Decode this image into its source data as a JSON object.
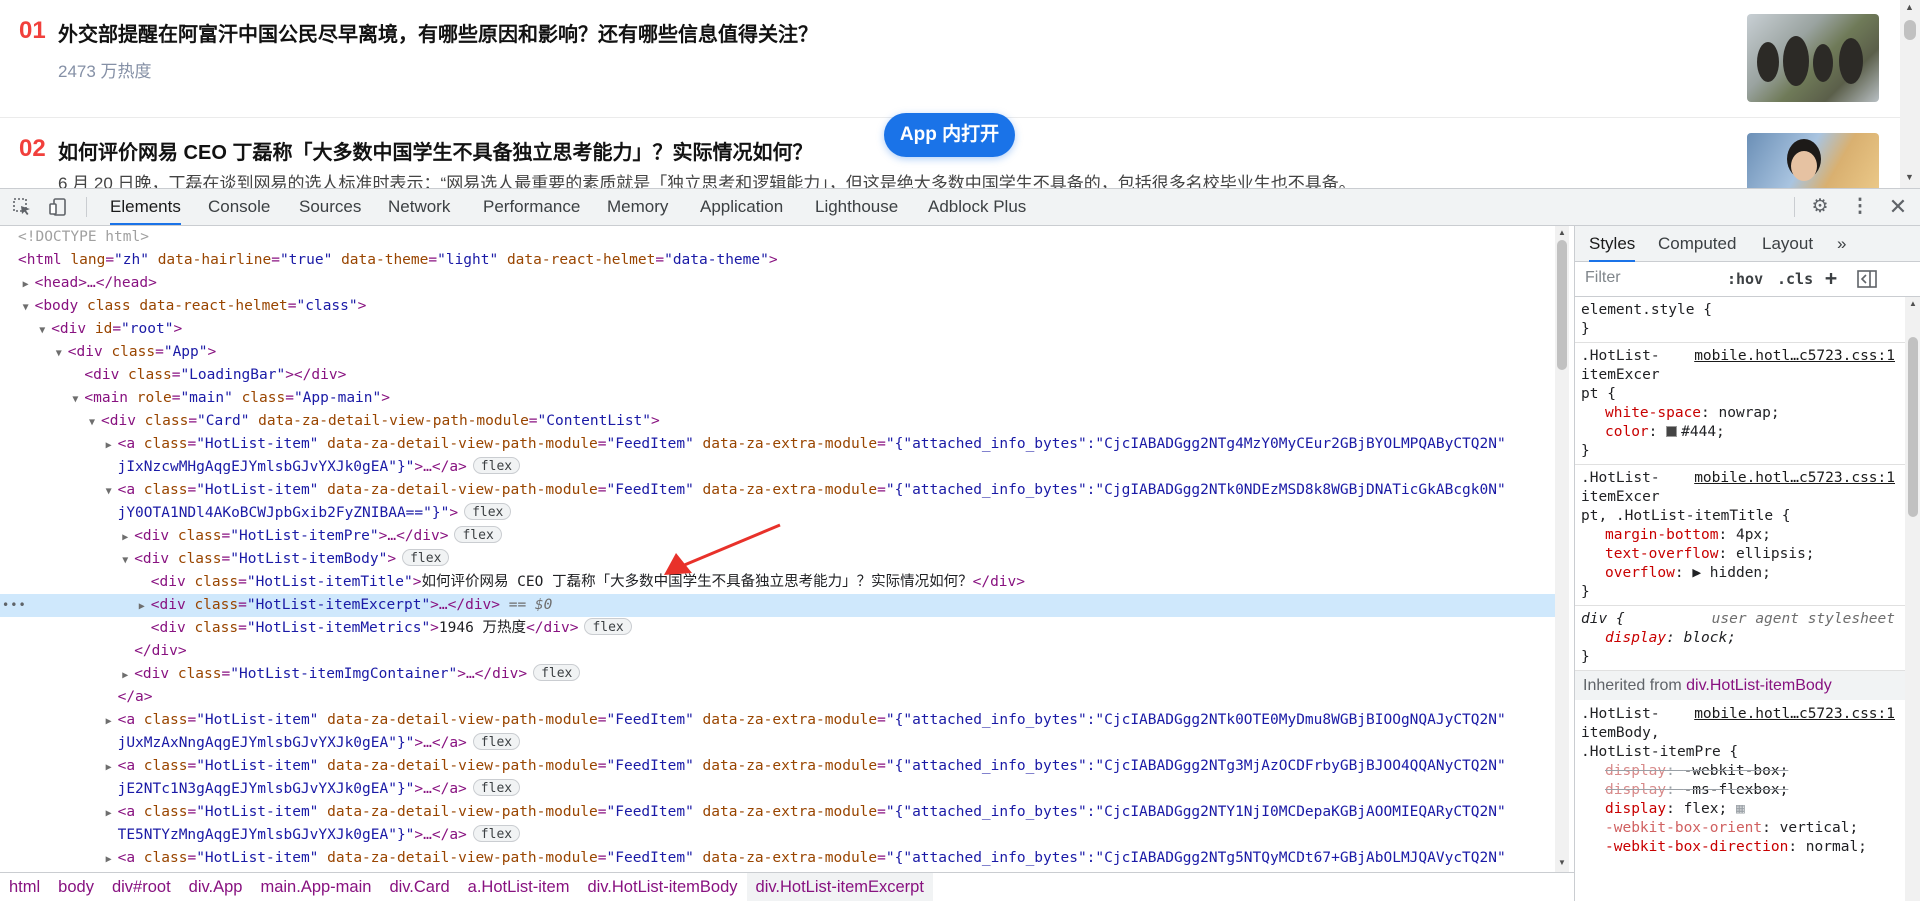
{
  "page": {
    "items": [
      {
        "rank": "01",
        "title": "外交部提醒在阿富汗中国公民尽早离境，有哪些原因和影响？还有哪些信息值得关注？",
        "metric": "2473 万热度"
      },
      {
        "rank": "02",
        "title": "如何评价网易 CEO 丁磊称「大多数中国学生不具备独立思考能力」？实际情况如何？",
        "excerpt": "6 月 20 日晚，丁磊在谈到网易的选人标准时表示：“网易选人最重要的素质就是「独立思考和逻辑能力」，但这是绝大多数中国学生不具备的，包括很多名校毕业生也不具备。"
      }
    ],
    "app_button": "App 内打开"
  },
  "devtools": {
    "tabs": [
      "Elements",
      "Console",
      "Sources",
      "Network",
      "Performance",
      "Memory",
      "Application",
      "Lighthouse",
      "Adblock Plus"
    ],
    "active_tab": "Elements",
    "tree": [
      {
        "indent": 0,
        "tri": "",
        "html": "doctype",
        "text": "<!DOCTYPE html>"
      },
      {
        "indent": 0,
        "tri": "",
        "tag": "html",
        "attrs": [
          [
            "lang",
            "zh"
          ],
          [
            "data-hairline",
            "true"
          ],
          [
            "data-theme",
            "light"
          ],
          [
            "data-react-helmet",
            "data-theme"
          ]
        ],
        "close": ">"
      },
      {
        "indent": 1,
        "tri": "▶",
        "tag": "head",
        "tail": ">…</head>"
      },
      {
        "indent": 1,
        "tri": "▼",
        "tag": "body",
        "attrs": [
          [
            "class",
            null
          ],
          [
            "data-react-helmet",
            "class"
          ]
        ],
        "close": ">"
      },
      {
        "indent": 2,
        "tri": "▼",
        "tag": "div",
        "attrs": [
          [
            "id",
            "root"
          ]
        ],
        "close": ">"
      },
      {
        "indent": 3,
        "tri": "▼",
        "tag": "div",
        "attrs": [
          [
            "class",
            "App"
          ]
        ],
        "close": ">"
      },
      {
        "indent": 4,
        "tri": "",
        "tag": "div",
        "attrs": [
          [
            "class",
            "LoadingBar"
          ]
        ],
        "tail": "></div>"
      },
      {
        "indent": 4,
        "tri": "▼",
        "tag": "main",
        "attrs": [
          [
            "role",
            "main"
          ],
          [
            "class",
            "App-main"
          ]
        ],
        "close": ">"
      },
      {
        "indent": 5,
        "tri": "▼",
        "tag": "div",
        "attrs": [
          [
            "class",
            "Card"
          ],
          [
            "data-za-detail-view-path-module",
            "ContentList"
          ]
        ],
        "close": ">"
      },
      {
        "indent": 6,
        "tri": "▶",
        "tag": "a",
        "attrs": [
          [
            "class",
            "HotList-item"
          ],
          [
            "data-za-detail-view-path-module",
            "FeedItem"
          ],
          [
            "data-za-extra-module",
            "{\"attached_info_bytes\":\"CjcIABADGgg2NTg4MzY0MyCEur2GBjBYOLMPQAByCTQ2N"
          ]
        ],
        "close": ""
      },
      {
        "indent": 6,
        "tri": "",
        "cont": "jIxNzcwMHgAqgEJYmlsbGJvYXJk0gEA\"}\">…</a>",
        "badge": "flex"
      },
      {
        "indent": 6,
        "tri": "▼",
        "tag": "a",
        "attrs": [
          [
            "class",
            "HotList-item"
          ],
          [
            "data-za-detail-view-path-module",
            "FeedItem"
          ],
          [
            "data-za-extra-module",
            "{\"attached_info_bytes\":\"CjgIABADGgg2NTk0NDEzMSD8k8WGBjDNATicGkABcgk0N"
          ]
        ],
        "close": ""
      },
      {
        "indent": 6,
        "tri": "",
        "cont": "jY0OTA1NDl4AKoBCWJpbGxib2FyZNIBAA==\"}\">",
        "badge": "flex"
      },
      {
        "indent": 7,
        "tri": "▶",
        "tag": "div",
        "attrs": [
          [
            "class",
            "HotList-itemPre"
          ]
        ],
        "tail": ">…</div>",
        "badge": "flex"
      },
      {
        "indent": 7,
        "tri": "▼",
        "tag": "div",
        "attrs": [
          [
            "class",
            "HotList-itemBody"
          ]
        ],
        "close": ">",
        "badge": "flex"
      },
      {
        "indent": 8,
        "tri": "",
        "tag": "div",
        "attrs": [
          [
            "class",
            "HotList-itemTitle"
          ]
        ],
        "close": ">",
        "text_after": "如何评价网易 CEO 丁磊称「大多数中国学生不具备独立思考能力」？实际情况如何？",
        "end": "</div>"
      },
      {
        "indent": 8,
        "tri": "▶",
        "tag": "div",
        "attrs": [
          [
            "class",
            "HotList-itemExcerpt"
          ]
        ],
        "tail": ">…</div>",
        "eq": " == $0",
        "selected": true
      },
      {
        "indent": 8,
        "tri": "",
        "tag": "div",
        "attrs": [
          [
            "class",
            "HotList-itemMetrics"
          ]
        ],
        "close": ">",
        "text_after": "1946 万热度",
        "end": "</div>",
        "badge": "flex"
      },
      {
        "indent": 7,
        "tri": "",
        "end_only": "</div>"
      },
      {
        "indent": 7,
        "tri": "▶",
        "tag": "div",
        "attrs": [
          [
            "class",
            "HotList-itemImgContainer"
          ]
        ],
        "tail": ">…</div>",
        "badge": "flex"
      },
      {
        "indent": 6,
        "tri": "",
        "end_only": "</a>"
      },
      {
        "indent": 6,
        "tri": "▶",
        "tag": "a",
        "attrs": [
          [
            "class",
            "HotList-item"
          ],
          [
            "data-za-detail-view-path-module",
            "FeedItem"
          ],
          [
            "data-za-extra-module",
            "{\"attached_info_bytes\":\"CjcIABADGgg2NTk0OTE0MyDmu8WGBjBIOOgNQAJyCTQ2N"
          ]
        ],
        "close": ""
      },
      {
        "indent": 6,
        "tri": "",
        "cont": "jUxMzAxNngAqgEJYmlsbGJvYXJk0gEA\"}\">…</a>",
        "badge": "flex"
      },
      {
        "indent": 6,
        "tri": "▶",
        "tag": "a",
        "attrs": [
          [
            "class",
            "HotList-item"
          ],
          [
            "data-za-detail-view-path-module",
            "FeedItem"
          ],
          [
            "data-za-extra-module",
            "{\"attached_info_bytes\":\"CjcIABADGgg2NTg3MjAzOCDFrbyGBjBJOO4QQANyCTQ2N"
          ]
        ],
        "close": ""
      },
      {
        "indent": 6,
        "tri": "",
        "cont": "jE2NTc1N3gAqgEJYmlsbGJvYXJk0gEA\"}\">…</a>",
        "badge": "flex"
      },
      {
        "indent": 6,
        "tri": "▶",
        "tag": "a",
        "attrs": [
          [
            "class",
            "HotList-item"
          ],
          [
            "data-za-detail-view-path-module",
            "FeedItem"
          ],
          [
            "data-za-extra-module",
            "{\"attached_info_bytes\":\"CjcIABADGgg2NTY1NjI0MCDepaKGBjAOOMIEQARyCTQ2N"
          ]
        ],
        "close": ""
      },
      {
        "indent": 6,
        "tri": "",
        "cont": "TE5NTYzMngAqgEJYmlsbGJvYXJk0gEA\"}\">…</a>",
        "badge": "flex"
      },
      {
        "indent": 6,
        "tri": "▶",
        "tag": "a",
        "attrs": [
          [
            "class",
            "HotList-item"
          ],
          [
            "data-za-detail-view-path-module",
            "FeedItem"
          ],
          [
            "data-za-extra-module",
            "{\"attached_info_bytes\":\"CjcIABADGgg2NTg5NTQyMCDt67+GBjAbOLMJQAVycTQ2N"
          ]
        ],
        "close": ""
      }
    ],
    "breadcrumbs": [
      "html",
      "body",
      "div#root",
      "div.App",
      "main.App-main",
      "div.Card",
      "a.HotList-item",
      "div.HotList-itemBody",
      "div.HotList-itemExcerpt"
    ],
    "styles": {
      "tabs": [
        "Styles",
        "Computed",
        "Layout",
        "»"
      ],
      "filter_placeholder": "Filter",
      "hov": ":hov",
      "cls": ".cls",
      "plus": "+",
      "rules": [
        {
          "sel": "element.style {",
          "props": [],
          "end": "}"
        },
        {
          "sel_lines": [
            ".HotList-",
            "itemExcer",
            "pt {"
          ],
          "src": "mobile.hotl…c5723.css:1",
          "props": [
            [
              "white-space",
              "nowrap;"
            ],
            [
              "color",
              "#444;",
              "swatch"
            ]
          ],
          "end": "}"
        },
        {
          "sel_lines": [
            ".HotList-",
            "itemExcer",
            "pt, .HotList-itemTitle {"
          ],
          "src": "mobile.hotl…c5723.css:1",
          "props": [
            [
              "margin-bottom",
              "4px;"
            ],
            [
              "text-overflow",
              "ellipsis;"
            ],
            [
              "overflow",
              "hidden;",
              "tri"
            ]
          ],
          "end": "}"
        },
        {
          "sel_lines": [
            "div {"
          ],
          "ua": "user agent stylesheet",
          "props": [
            [
              "display",
              "block;"
            ]
          ],
          "end": "}"
        }
      ],
      "inherited_label": "Inherited from ",
      "inherited_sel": "div.HotList-itemBody",
      "rule2": {
        "sel_lines": [
          ".HotList-",
          "itemBody,",
          ".HotList-itemPre {"
        ],
        "src": "mobile.hotl…c5723.css:1",
        "props": [
          [
            "display",
            "-webkit-box;",
            "strike"
          ],
          [
            "display",
            "-ms-flexbox;",
            "strike"
          ],
          [
            "display",
            "flex;",
            "grid"
          ],
          [
            "-webkit-box-orient",
            "vertical;",
            "dim"
          ],
          [
            "-webkit-box-direction",
            "normal;",
            ""
          ]
        ]
      }
    }
  }
}
